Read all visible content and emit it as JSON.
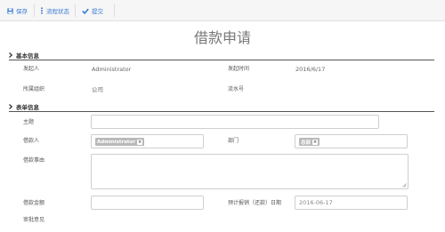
{
  "toolbar": {
    "save_label": "保存",
    "flow_label": "流程状态",
    "submit_label": "提交"
  },
  "form": {
    "title": "借款申请"
  },
  "basic": {
    "section_title": "基本信息",
    "initiator_label": "发起人",
    "initiator_value": "Administrator",
    "time_label": "发起时间",
    "time_value": "2016/6/17",
    "org_label": "所属组织",
    "org_value": "公司",
    "serial_label": "流水号",
    "serial_value": ""
  },
  "detail": {
    "section_title": "表单信息",
    "subject_label": "主题",
    "subject_value": "",
    "borrower_label": "借款人",
    "borrower_tag": "Administrator",
    "dept_label": "部门",
    "dept_tag": "总部",
    "reason_label": "借款事由",
    "reason_value": "",
    "amount_label": "借款金额",
    "amount_value": "",
    "expected_label": "预计报销（还款）日期",
    "expected_value": "2016-06-17",
    "approval_label": "审批意见"
  },
  "icons": {
    "save": "save-icon",
    "flow": "list-icon",
    "submit": "check-icon",
    "section": "chevron-right-icon",
    "remove": "close-icon"
  },
  "colors": {
    "accent": "#3a7bd5",
    "tag_bg": "#b9b9b9"
  }
}
